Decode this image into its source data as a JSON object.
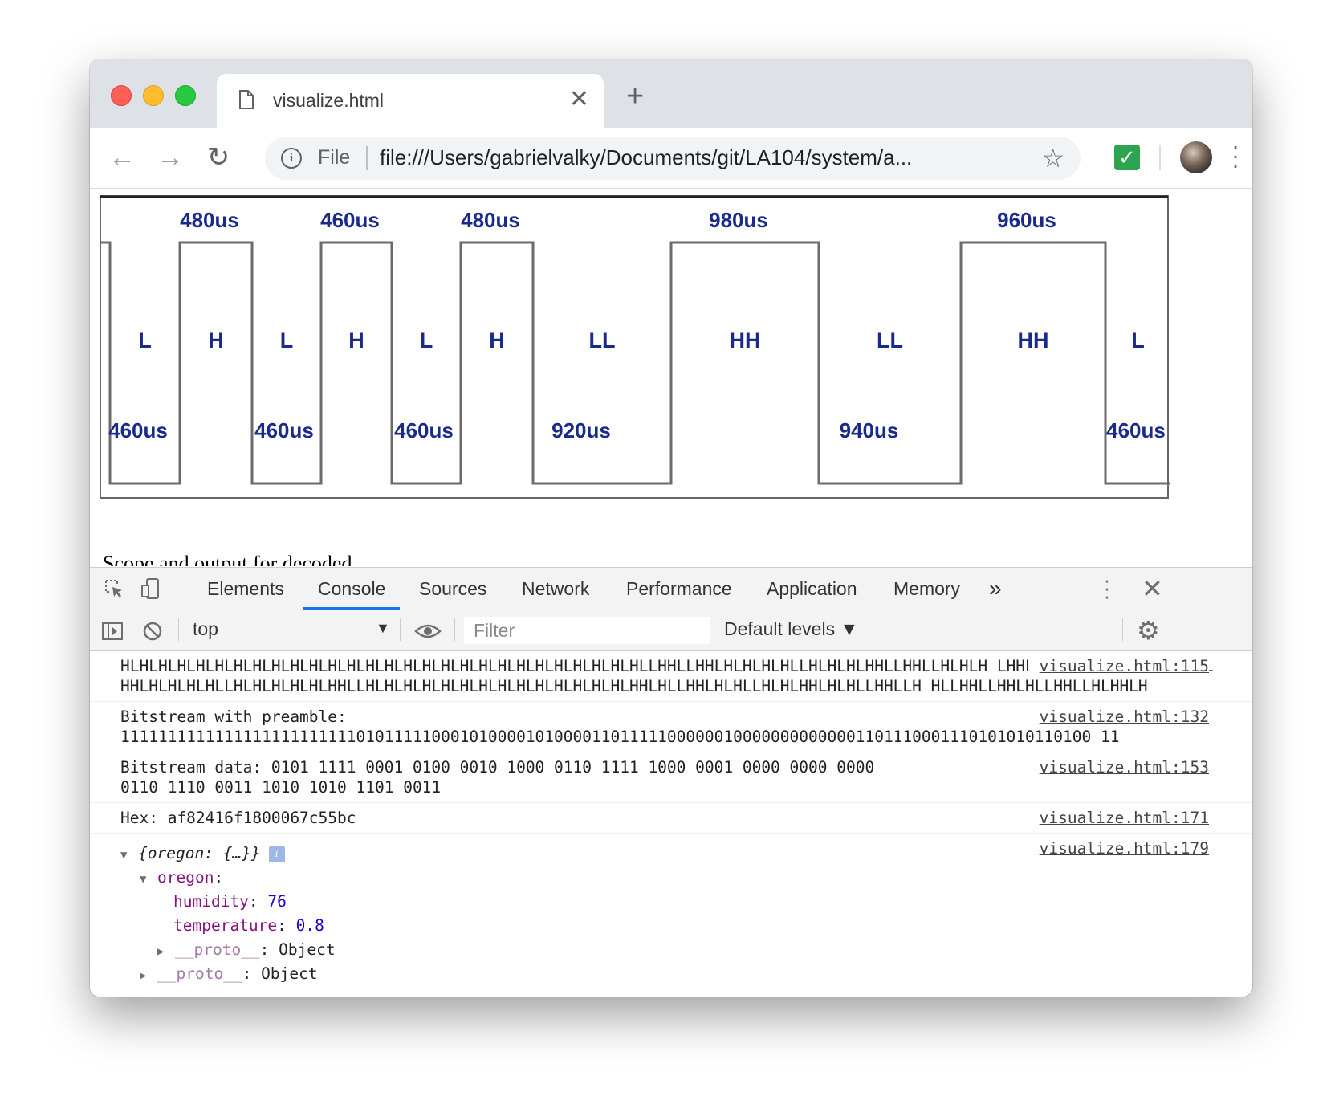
{
  "browser": {
    "tab_title": "visualize.html",
    "url_scheme": "File",
    "url": "file:///Users/gabrielvalky/Documents/git/LA104/system/a..."
  },
  "page": {
    "bits": [
      "L",
      "H",
      "L",
      "H",
      "L",
      "H",
      "LL",
      "HH",
      "LL",
      "HH",
      "L"
    ],
    "high_durations": [
      "480us",
      "460us",
      "480us",
      "980us",
      "960us"
    ],
    "low_durations": [
      "460us",
      "460us",
      "460us",
      "920us",
      "940us",
      "460us"
    ],
    "cutoff_text": "Scope and output for decoded"
  },
  "devtools": {
    "tabs": [
      "Elements",
      "Console",
      "Sources",
      "Network",
      "Performance",
      "Application",
      "Memory"
    ],
    "active_tab": "Console",
    "context": "top",
    "filter_placeholder": "Filter",
    "levels": "Default levels ▼",
    "messages": [
      {
        "text": "HLHLHLHLHLHLHLHLHLHLHLHLHLHLHLHLHLHLHLHLHLHLHLHLHLHLHLHLLHHLLHHLHLHLHLHLLHLHLHLHHLLHHLLHLHLH LHHLLHHLLHLHLHLHLHHLHLLHHLHLHLHLHLLHLHLHLHLHLHHLLHLHLHLHLHLHLHLHLHLHLHLHLHLHLHHLHLLHHLHLHLLHLHLHHLHLHLLHHLLH HLLHHLLHHLHLLHHLLHLHHLH",
        "source": "visualize.html:115"
      },
      {
        "text": "Bitstream with preamble:\n1111111111111111111111111010111110001010000101000011011111000000100000000000001101110001110101010110100 11",
        "source": "visualize.html:132"
      },
      {
        "text": "Bitstream data: 0101 1111 0001 0100 0010 1000 0110 1111 1000 0001 0000 0000 0000\n0110 1110 0011 1010 1010 1101 0011",
        "source": "visualize.html:153"
      },
      {
        "text": "Hex: af82416f1800067c55bc",
        "source": "visualize.html:171"
      }
    ],
    "object": {
      "summary": "{oregon: {…}}",
      "source": "visualize.html:179",
      "root_key": "oregon",
      "humidity_key": "humidity",
      "humidity": "76",
      "temperature_key": "temperature",
      "temperature": "0.8",
      "proto_key": "__proto__",
      "proto_value": "Object",
      "proto_key_outer": "__proto__",
      "proto_value_outer": "Object"
    }
  }
}
